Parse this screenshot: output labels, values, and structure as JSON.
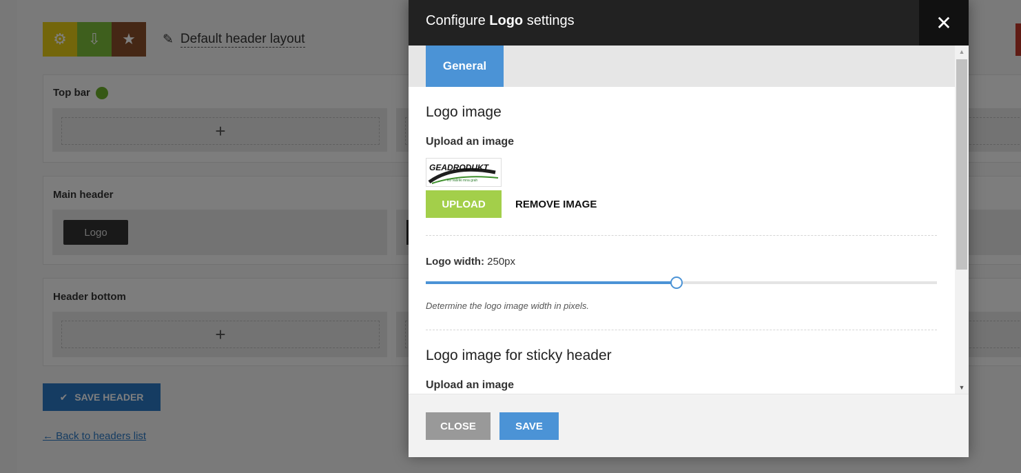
{
  "background": {
    "layout_title": "Default header layout",
    "rows": [
      {
        "label": "Top bar",
        "status": "active"
      },
      {
        "label": "Main header",
        "chip": "Logo"
      },
      {
        "label": "Header bottom"
      }
    ],
    "add_symbol": "+",
    "save_header_label": "SAVE HEADER",
    "back_link": "← Back to headers list"
  },
  "modal": {
    "title_prefix": "Configure",
    "title_bold": "Logo",
    "title_suffix": "settings",
    "close_icon": "✕",
    "tab_general": "General",
    "logo_section_title": "Logo image",
    "upload_label": "Upload an image",
    "logo_brand_text": "GEADRODUKT",
    "logo_tagline": "Ko vašriki mna grah",
    "upload_button": "UPLOAD",
    "remove_button": "REMOVE IMAGE",
    "width_label": "Logo width:",
    "width_value": "250px",
    "width_fraction": 0.49,
    "help_text": "Determine the logo image width in pixels.",
    "sticky_section_title": "Logo image for sticky header",
    "sticky_upload_label": "Upload an image",
    "footer_close": "CLOSE",
    "footer_save": "SAVE"
  },
  "colors": {
    "accent_blue": "#4b93d6",
    "upload_green": "#a3cf4a"
  }
}
